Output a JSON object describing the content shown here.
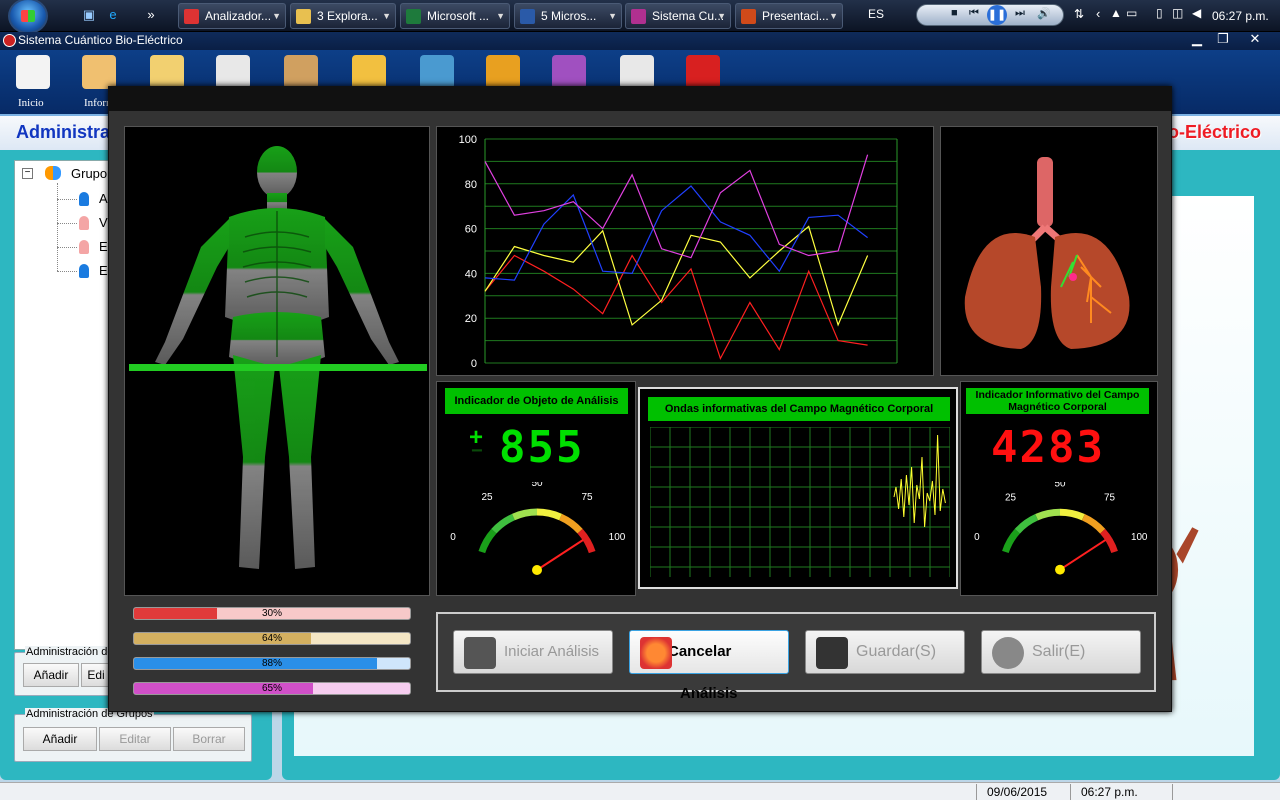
{
  "taskbar": {
    "tasks": [
      {
        "label": "Analizador...",
        "icon": "chrome-icon",
        "color": "#d33"
      },
      {
        "label": "3 Explora...",
        "icon": "folder-icon",
        "color": "#e8c050"
      },
      {
        "label": "Microsoft ...",
        "icon": "excel-icon",
        "color": "#1e7a3c"
      },
      {
        "label": "5 Micros...",
        "icon": "word-icon",
        "color": "#2a5aa8"
      },
      {
        "label": "Sistema Cu...",
        "icon": "app-icon",
        "color": "#b03090"
      },
      {
        "label": "Presentaci...",
        "icon": "powerpoint-icon",
        "color": "#d04a1a"
      }
    ],
    "lang": "ES",
    "clock": "06:27 p.m."
  },
  "app": {
    "title": "Sistema Cuántico Bio-Eléctrico",
    "toolbar": [
      {
        "label": "Inicio",
        "icon": "home-icon"
      },
      {
        "label": "Inform",
        "icon": "users-icon"
      },
      {
        "label": "",
        "icon": "hand-icon"
      },
      {
        "label": "",
        "icon": "clipboard-icon"
      },
      {
        "label": "",
        "icon": "report-icon"
      },
      {
        "label": "",
        "icon": "import-icon"
      },
      {
        "label": "",
        "icon": "export-icon"
      },
      {
        "label": "",
        "icon": "settings-icon"
      },
      {
        "label": "",
        "icon": "help-icon"
      },
      {
        "label": "",
        "icon": "profile-icon"
      },
      {
        "label": "",
        "icon": "power-icon"
      }
    ],
    "admin_left": "Administra",
    "admin_right": "o-Eléctrico"
  },
  "tree": {
    "root": "Grupo",
    "items": [
      {
        "label": "A",
        "color": "#1a7be0"
      },
      {
        "label": "V",
        "color": "#f4a5a5"
      },
      {
        "label": "E",
        "color": "#f4a5a5"
      },
      {
        "label": "E",
        "color": "#1a7be0"
      }
    ]
  },
  "admin_persons": {
    "title": "Administración de",
    "add": "Añadir",
    "edit": "Edi"
  },
  "admin_groups": {
    "title": "Administración de Grupos",
    "add": "Añadir",
    "edit": "Editar",
    "delete": "Borrar"
  },
  "status": {
    "date": "09/06/2015",
    "time": "06:27 p.m."
  },
  "dialog": {
    "indicator_object": {
      "title": "Indicador de Objeto de Análisis",
      "sign_plus": "+",
      "sign_minus": "−",
      "value": "855",
      "color": "#00e000"
    },
    "waves": {
      "title": "Ondas informativas del Campo Magnético Corporal"
    },
    "indicator_info": {
      "title": "Indicador Informativo del Campo Magnético Corporal",
      "value": "4283",
      "color": "#ff1010"
    },
    "gauge_labels": [
      "0",
      "25",
      "50",
      "75",
      "100"
    ],
    "progress": [
      {
        "label": "30%",
        "value": 0.3,
        "color": "#e03a3a",
        "track": "#f7c9c9"
      },
      {
        "label": "64%",
        "value": 0.64,
        "color": "#d4b060",
        "track": "#f4e6c4"
      },
      {
        "label": "88%",
        "value": 0.88,
        "color": "#2a8fe8",
        "track": "#cfe6fb"
      },
      {
        "label": "65%",
        "value": 0.65,
        "color": "#d050c8",
        "track": "#f6cdef"
      }
    ],
    "buttons": {
      "start": "Iniciar Análisis",
      "cancel": "Cancelar Análisis",
      "save": "Guardar(S)",
      "exit": "Salir(E)"
    }
  },
  "chart_data": {
    "type": "line",
    "title": "",
    "xlabel": "",
    "ylabel": "",
    "ylim": [
      0,
      100
    ],
    "yticks": [
      "0",
      "20",
      "40",
      "60",
      "80",
      "100"
    ],
    "grid": true,
    "x": [
      0,
      1,
      2,
      3,
      4,
      5,
      6,
      7,
      8,
      9,
      10,
      11,
      12,
      13,
      14
    ],
    "series": [
      {
        "color": "#ff2020",
        "values": [
          32,
          48,
          41,
          33,
          22,
          48,
          27,
          42,
          2,
          27,
          6,
          41,
          10,
          8,
          null
        ]
      },
      {
        "color": "#ffff40",
        "values": [
          32,
          52,
          48,
          45,
          59,
          17,
          28,
          57,
          54,
          38,
          50,
          61,
          17,
          48,
          null
        ]
      },
      {
        "color": "#2040ff",
        "values": [
          38,
          37,
          62,
          75,
          41,
          40,
          68,
          79,
          63,
          57,
          41,
          65,
          66,
          56,
          null
        ]
      },
      {
        "color": "#e040e0",
        "values": [
          90,
          66,
          68,
          72,
          60,
          84,
          51,
          47,
          76,
          86,
          53,
          48,
          50,
          93,
          null
        ]
      }
    ]
  }
}
